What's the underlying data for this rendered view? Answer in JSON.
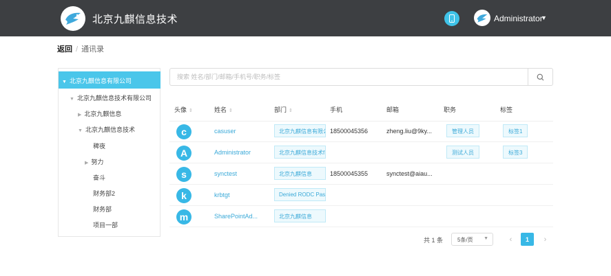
{
  "header": {
    "app_title": "北京九麒信息技术",
    "user_name": "Administrator",
    "logo_icon": "bird-logo",
    "phone_icon": "phone-icon",
    "accent_color": "#3fc3e8",
    "bar_color": "#3d3f42"
  },
  "breadcrumb": {
    "back": "返回",
    "separator": "/",
    "current": "通讯录"
  },
  "tree": {
    "root": "北京九麒信息有限公司",
    "nodes": [
      {
        "label": "北京九麒信息技术有限公司"
      },
      {
        "label": "北京九麒信息"
      },
      {
        "label": "北京九麒信息技术"
      },
      {
        "label": "稗夜"
      },
      {
        "label": "努力"
      },
      {
        "label": "奋斗"
      },
      {
        "label": "财务部2"
      },
      {
        "label": "财务部"
      },
      {
        "label": "项目一部"
      }
    ]
  },
  "search": {
    "placeholder": "搜索 姓名/部门/邮箱/手机号/职务/标签",
    "value": ""
  },
  "table": {
    "columns": [
      {
        "label": "头像"
      },
      {
        "label": "姓名"
      },
      {
        "label": "部门"
      },
      {
        "label": "手机"
      },
      {
        "label": "邮箱"
      },
      {
        "label": "职务"
      },
      {
        "label": "标签"
      }
    ],
    "rows": [
      {
        "initial": "c",
        "name": "casuser",
        "dept": "北京九麒信息有限公",
        "mobile": "18500045356",
        "email": "zheng.liu@9ky...",
        "position": "管理人员",
        "tag": "标签1"
      },
      {
        "initial": "A",
        "name": "Administrator",
        "dept": "北京九麒信息技术f",
        "mobile": "",
        "email": "",
        "position": "测试人员",
        "tag": "标签3"
      },
      {
        "initial": "s",
        "name": "synctest",
        "dept": "北京九麒信息",
        "mobile": "18500045355",
        "email": "synctest@aiau...",
        "position": "",
        "tag": ""
      },
      {
        "initial": "k",
        "name": "krbtgt",
        "dept": "Denied RODC Pas",
        "mobile": "",
        "email": "",
        "position": "",
        "tag": ""
      },
      {
        "initial": "m",
        "name": "SharePointAd...",
        "dept": "北京九麒信息",
        "mobile": "",
        "email": "",
        "position": "",
        "tag": ""
      }
    ]
  },
  "pagination": {
    "total": "共 1 条",
    "page_size": "5条/页",
    "prev": "‹",
    "current_page": "1",
    "next": "›"
  }
}
